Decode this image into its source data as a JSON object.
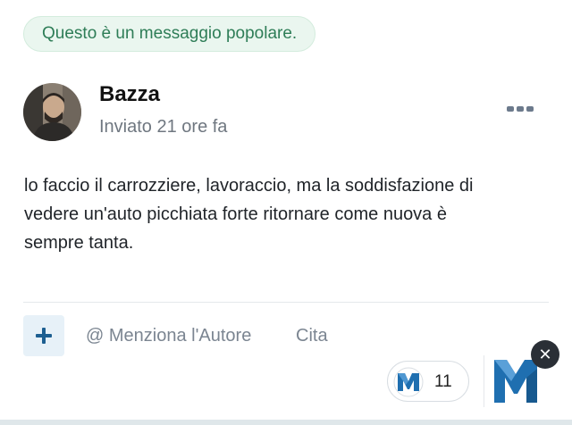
{
  "badge": {
    "text": "Questo è un messaggio popolare."
  },
  "post": {
    "author": "Bazza",
    "time": "Inviato 21 ore fa",
    "body_lines": [
      "lo faccio il carrozziere, lavoraccio, ma la soddisfazione di",
      "vedere un'auto picchiata forte ritornare come nuova è",
      "sempre tanta."
    ]
  },
  "actions": {
    "add_icon": "plus-icon",
    "mention": "@ Menziona l'Autore",
    "quote": "Cita"
  },
  "reactions": {
    "count": "11",
    "icon": "reaction-logo-icon",
    "close_icon": "close-icon",
    "close_glyph": "✕"
  },
  "colors": {
    "badge_bg": "#eaf6ef",
    "badge_text": "#2e7d57",
    "accent_blue": "#1d5f91",
    "muted_text": "#7b8591",
    "logo_blue": "#1f6fb0"
  }
}
